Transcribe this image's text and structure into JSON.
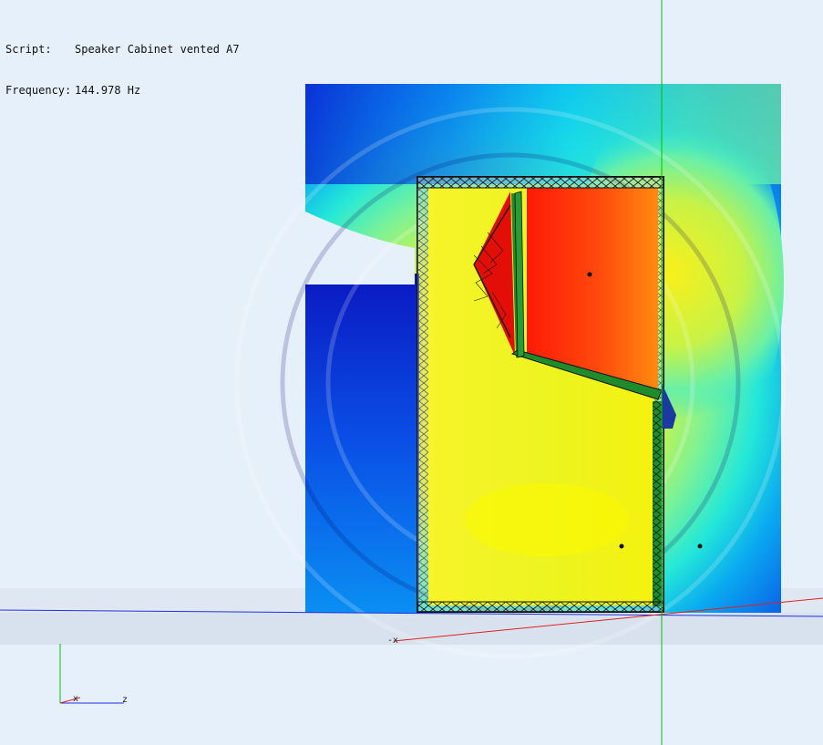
{
  "info": {
    "script_label": "Script:",
    "script_value": "Speaker Cabinet vented A7",
    "frequency_label": "Frequency:",
    "frequency_value": "144.978 Hz"
  },
  "axes": {
    "neg_x_label": "-x",
    "gizmo_x_label": "x",
    "gizmo_z_label": "z"
  },
  "colors": {
    "background": "#e6f0fb",
    "ground_plane": "#dde6f1",
    "field_low": "#0a1fd0",
    "field_mid": "#22e6e0",
    "field_high_yellow": "#f2f51a",
    "field_peak": "#ff2a10",
    "mesh_line": "#111111",
    "baffle_green": "#1e8c2a",
    "axis_x": "#e02020",
    "axis_y": "#00c000",
    "axis_z": "#2030e0"
  }
}
